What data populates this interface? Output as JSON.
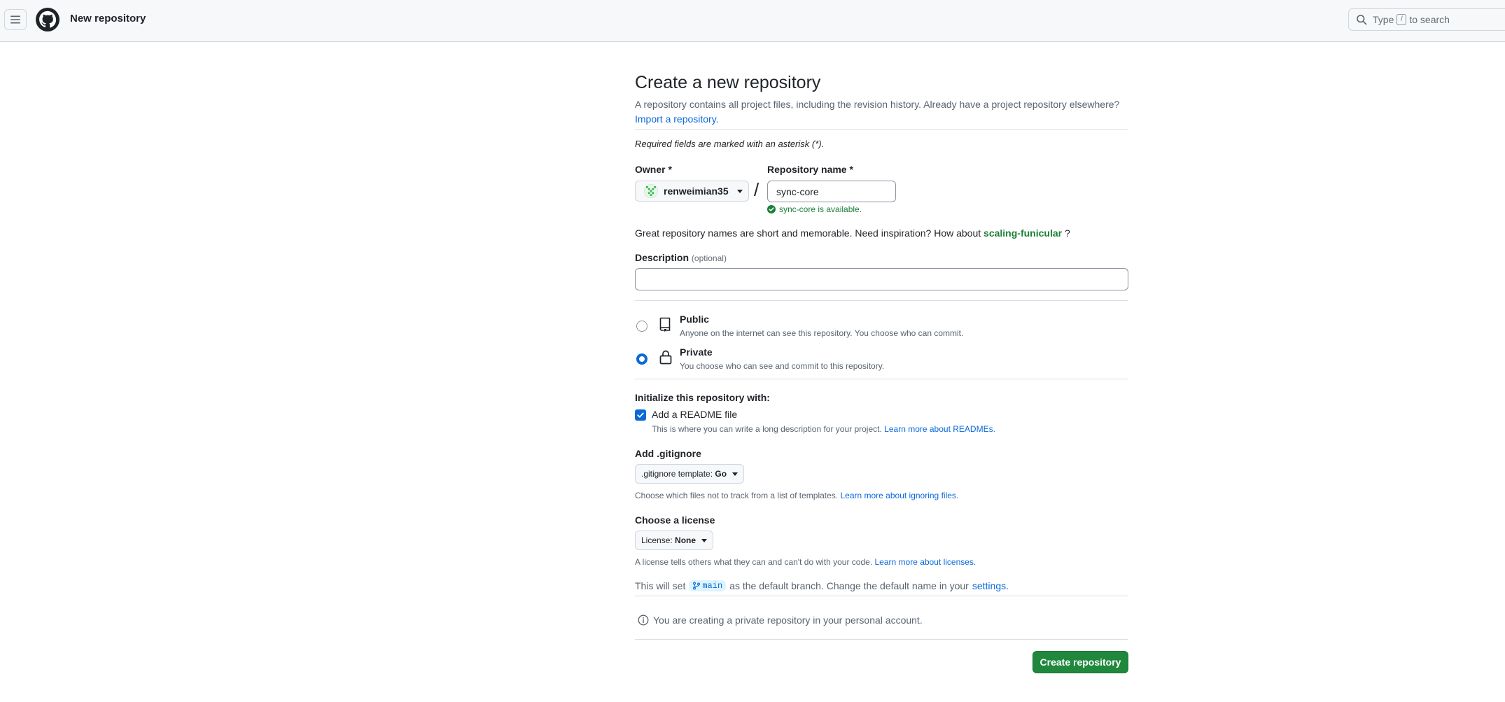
{
  "header": {
    "title": "New repository",
    "search_placeholder_prefix": "Type",
    "search_key": "/",
    "search_placeholder_suffix": "to search"
  },
  "page": {
    "title": "Create a new repository",
    "subtitle": "A repository contains all project files, including the revision history. Already have a project repository elsewhere?",
    "import_link": "Import a repository.",
    "required_note": "Required fields are marked with an asterisk (*)."
  },
  "owner": {
    "label": "Owner *",
    "value": "renweimian35"
  },
  "repo_name": {
    "label": "Repository name *",
    "value": "sync-core",
    "availability": "sync-core is available."
  },
  "suggestion": {
    "prefix": "Great repository names are short and memorable. Need inspiration? How about",
    "name": "scaling-funicular",
    "suffix": "?"
  },
  "description": {
    "label": "Description",
    "optional": "(optional)",
    "value": ""
  },
  "visibility": {
    "selected": "Private",
    "options": [
      {
        "title": "Public",
        "desc": "Anyone on the internet can see this repository. You choose who can commit."
      },
      {
        "title": "Private",
        "desc": "You choose who can see and commit to this repository."
      }
    ]
  },
  "init": {
    "heading": "Initialize this repository with:",
    "readme_label": "Add a README file",
    "readme_checked": true,
    "readme_desc": "This is where you can write a long description for your project.",
    "readme_link": "Learn more about READMEs."
  },
  "gitignore": {
    "label": "Add .gitignore",
    "select_prefix": ".gitignore template:",
    "select_value": "Go",
    "help": "Choose which files not to track from a list of templates.",
    "help_link": "Learn more about ignoring files."
  },
  "license": {
    "label": "Choose a license",
    "select_prefix": "License:",
    "select_value": "None",
    "help": "A license tells others what they can and can't do with your code.",
    "help_link": "Learn more about licenses."
  },
  "branch": {
    "prefix": "This will set",
    "name": "main",
    "suffix": "as the default branch. Change the default name in your",
    "link": "settings."
  },
  "notice": "You are creating a private repository in your personal account.",
  "submit_label": "Create repository",
  "colors": {
    "primary_button": "#1f883d",
    "link": "#0969da",
    "success": "#1a7f37"
  }
}
